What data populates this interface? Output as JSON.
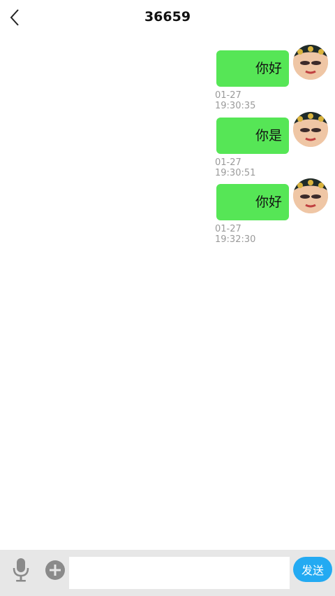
{
  "header": {
    "title": "36659"
  },
  "messages": [
    {
      "text": "你好",
      "timestamp": "01-27 19:30:35"
    },
    {
      "text": "你是",
      "timestamp": "01-27 19:30:51"
    },
    {
      "text": "你好",
      "timestamp": "01-27 19:32:30"
    }
  ],
  "footer": {
    "send_label": "发送",
    "input_value": ""
  },
  "colors": {
    "bubble": "#56e656",
    "send": "#23aaf2",
    "footer_bg": "#e7e7e7"
  }
}
